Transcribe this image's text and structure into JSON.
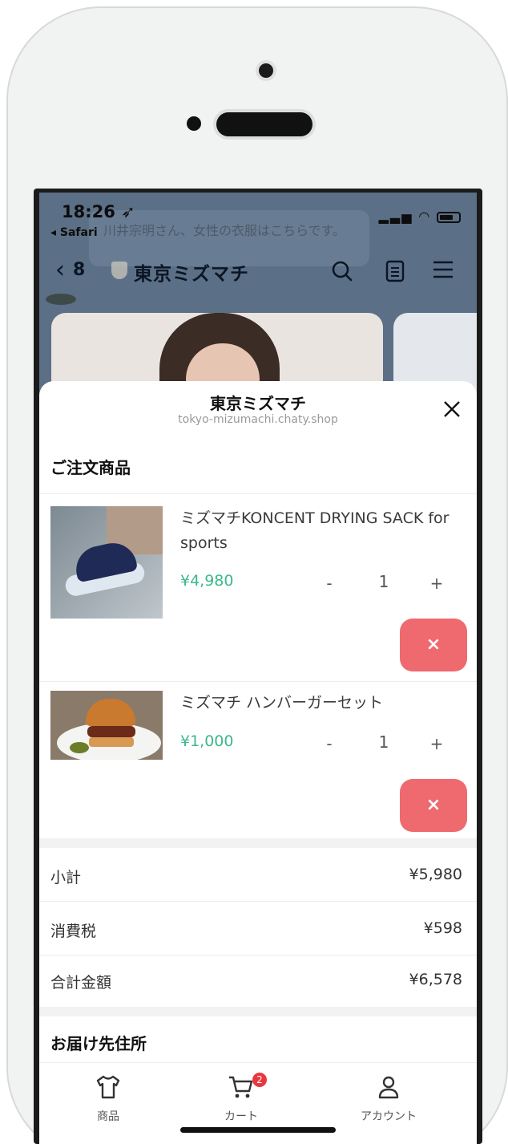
{
  "status_bar": {
    "time": "18:26",
    "back_app": "◂ Safari",
    "notification_preview": "川井宗明さん、女性の衣服はこちらです。"
  },
  "chat_header": {
    "unread_count": "8",
    "title": "東京ミズマチ"
  },
  "sheet": {
    "shop_name": "東京ミズマチ",
    "shop_url": "tokyo-mizumachi.chaty.shop",
    "order_section_title": "ご注文商品",
    "items": [
      {
        "name": "ミズマチKONCENT DRYING SACK for sports",
        "price": "¥4,980",
        "quantity": "1",
        "minus": "-",
        "plus": "+",
        "remove_label": "×"
      },
      {
        "name": "ミズマチ ハンバーガーセット",
        "price": "¥1,000",
        "quantity": "1",
        "minus": "-",
        "plus": "+",
        "remove_label": "×"
      }
    ],
    "summary": {
      "subtotal_label": "小計",
      "subtotal_value": "¥5,980",
      "tax_label": "消費税",
      "tax_value": "¥598",
      "total_label": "合計金額",
      "total_value": "¥6,578"
    },
    "address_section_title": "お届け先住所"
  },
  "tab_bar": {
    "tabs": [
      {
        "label": "商品",
        "icon": "shirt-icon"
      },
      {
        "label": "カート",
        "icon": "cart-icon",
        "badge": "2"
      },
      {
        "label": "アカウント",
        "icon": "person-icon"
      }
    ]
  },
  "colors": {
    "price_green": "#3cb98a",
    "remove_red": "#ee6a6f",
    "badge_red": "#e8383d"
  }
}
